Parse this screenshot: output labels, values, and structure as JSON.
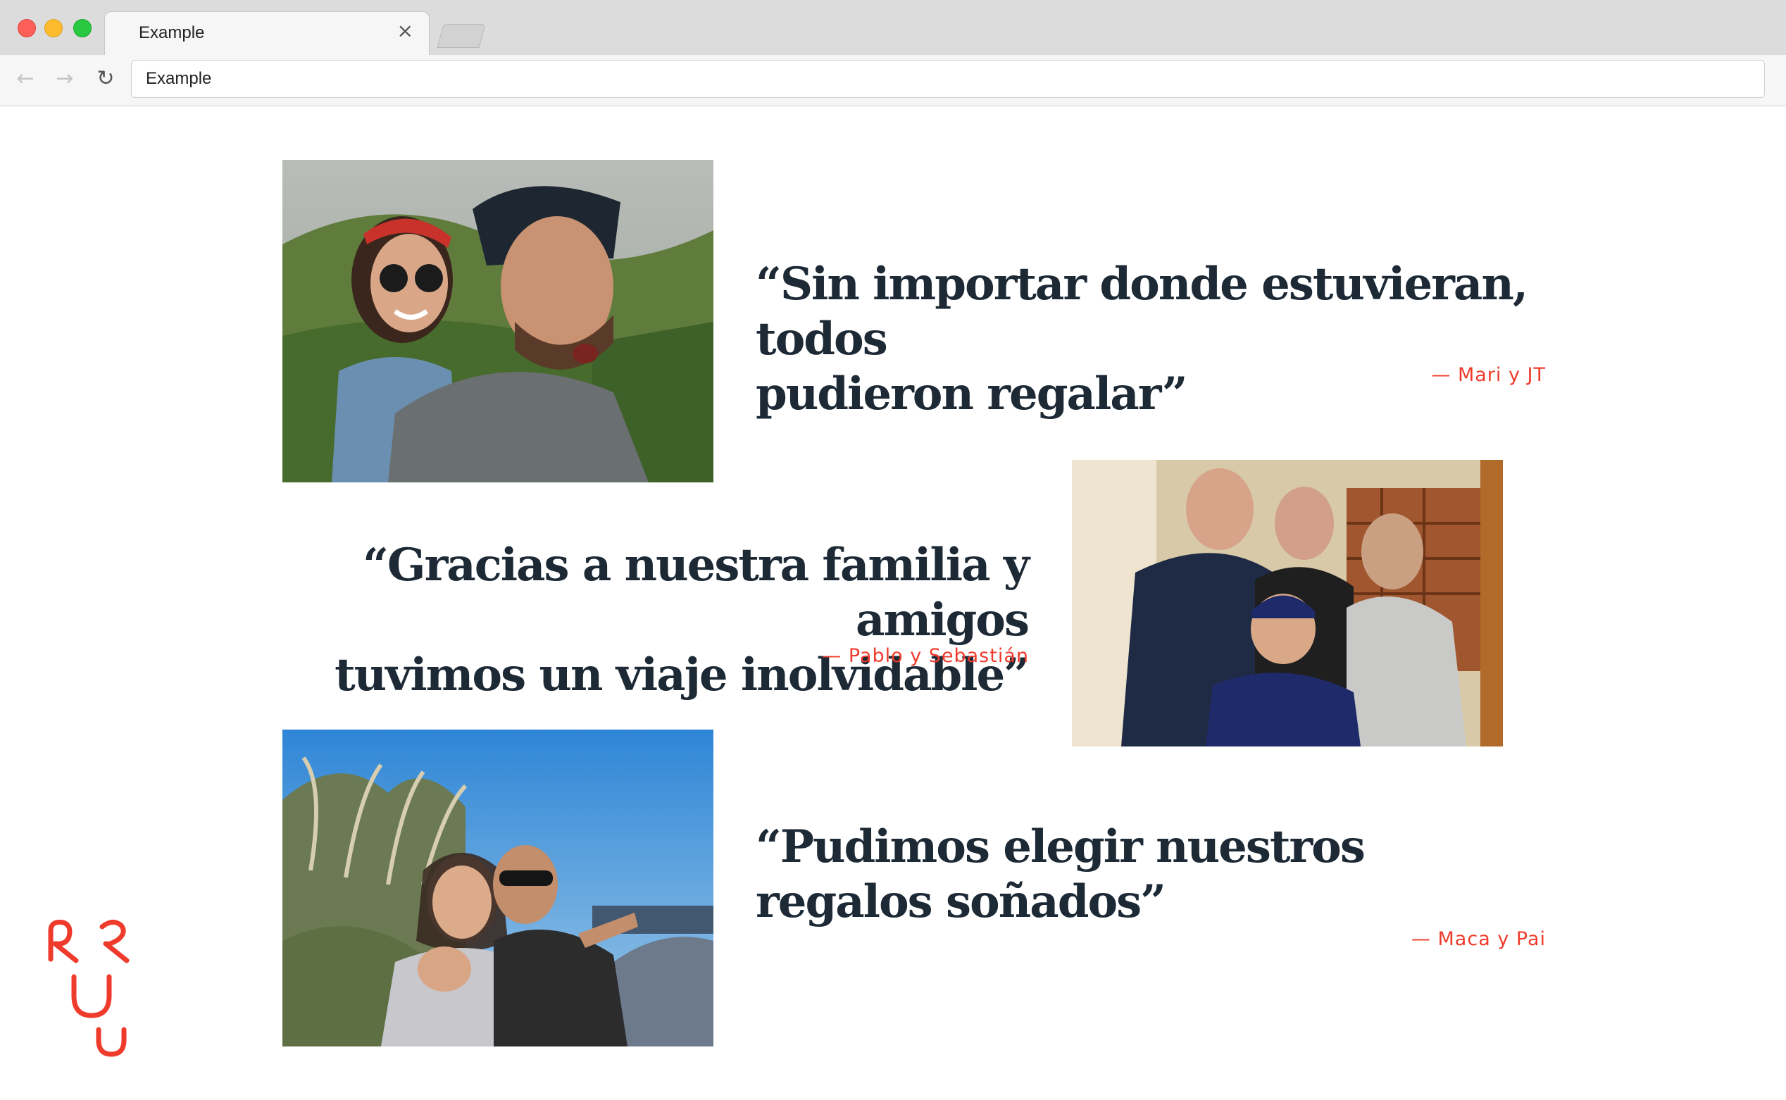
{
  "browser": {
    "tab_title": "Example",
    "tab_close": "×",
    "url": "Example",
    "back_icon": "←",
    "forward_icon": "→",
    "reload_icon": "↻"
  },
  "testimonials": [
    {
      "quote_line1": "“Sin importar donde estuvieran, todos",
      "quote_line2": "pudieron regalar”",
      "author": "— Mari y JT"
    },
    {
      "quote_line1": "“Gracias a nuestra familia y amigos",
      "quote_line2": "tuvimos un viaje inolvidable”",
      "author": "— Pablo y Sebastián"
    },
    {
      "quote_line1": "“Pudimos elegir nuestros",
      "quote_line2": "regalos soñados”",
      "author": "— Maca y Pai"
    }
  ],
  "colors": {
    "quote_text": "#1d2a36",
    "author_accent": "#ef3b2c",
    "logo": "#ef3b2c"
  }
}
